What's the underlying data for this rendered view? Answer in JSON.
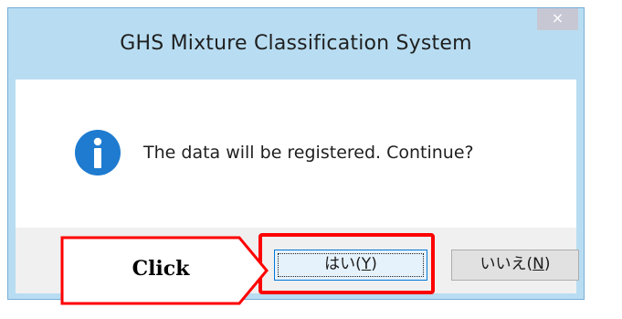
{
  "dialog": {
    "title": "GHS Mixture Classification System",
    "close_glyph": "×",
    "message": "The data will be registered. Continue?",
    "icon": "info-icon",
    "yes_button": {
      "label": "はい(",
      "accel": "Y",
      "suffix": ")"
    },
    "no_button": {
      "label": "いいえ(",
      "accel": "N",
      "suffix": ")"
    }
  },
  "annotation": {
    "callout_text": "Click",
    "highlight_color": "#ff0000"
  },
  "colors": {
    "titlebar": "#b8ddf2",
    "info_icon": "#1e7bd0",
    "footer": "#f0f0f0"
  }
}
